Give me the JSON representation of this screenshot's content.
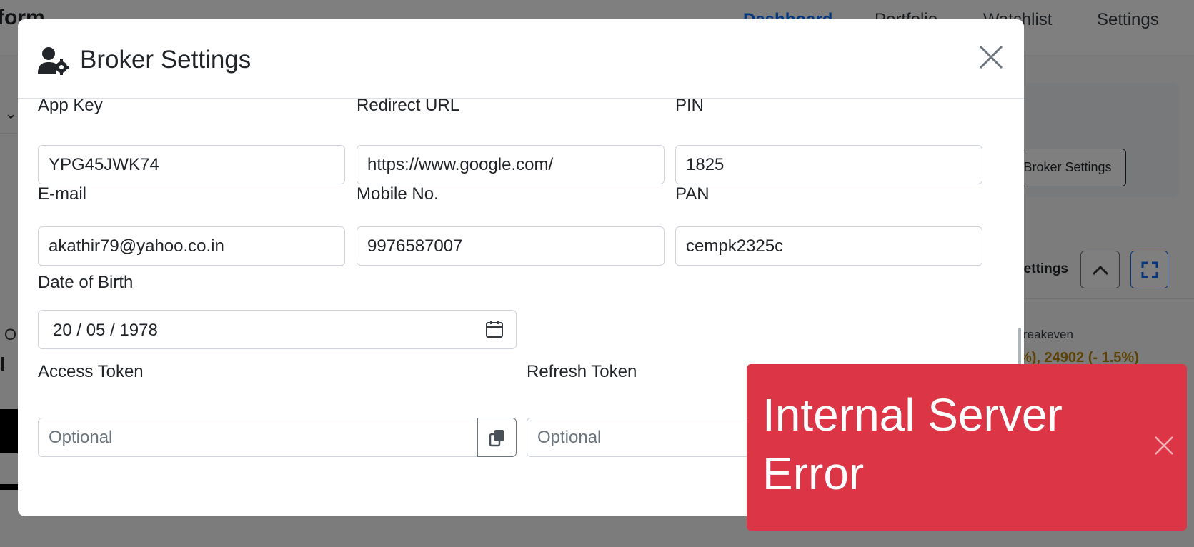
{
  "background": {
    "brand": "form",
    "nav": [
      "Dashboard",
      "Portfolio",
      "Watchlist",
      "Settings"
    ],
    "broker_settings_button": "Broker Settings",
    "settings_label": "Settings",
    "breakeven_label": "reakeven",
    "breakeven_value": "%), 24902 (- 1.5%)",
    "left_o": "O",
    "left_i": "I"
  },
  "modal": {
    "title": "Broker Settings",
    "fields": {
      "app_key": {
        "label": "App Key",
        "value": "YPG45JWK74"
      },
      "redirect_url": {
        "label": "Redirect URL",
        "value": "https://www.google.com/"
      },
      "pin": {
        "label": "PIN",
        "value": "1825"
      },
      "email": {
        "label": "E-mail",
        "value": "akathir79@yahoo.co.in"
      },
      "mobile": {
        "label": "Mobile No.",
        "value": "9976587007"
      },
      "pan": {
        "label": "PAN",
        "value": "cempk2325c"
      },
      "dob": {
        "label": "Date of Birth",
        "value": "20 / 05 / 1978"
      },
      "access_token": {
        "label": "Access Token",
        "placeholder": "Optional"
      },
      "refresh_token": {
        "label": "Refresh Token",
        "placeholder": "Optional"
      }
    }
  },
  "toast": {
    "message": "Internal Server Error",
    "color": "#dc3545"
  },
  "colors": {
    "accent": "#0d6efd",
    "danger": "#dc3545",
    "breakeven": "#b8860b"
  }
}
